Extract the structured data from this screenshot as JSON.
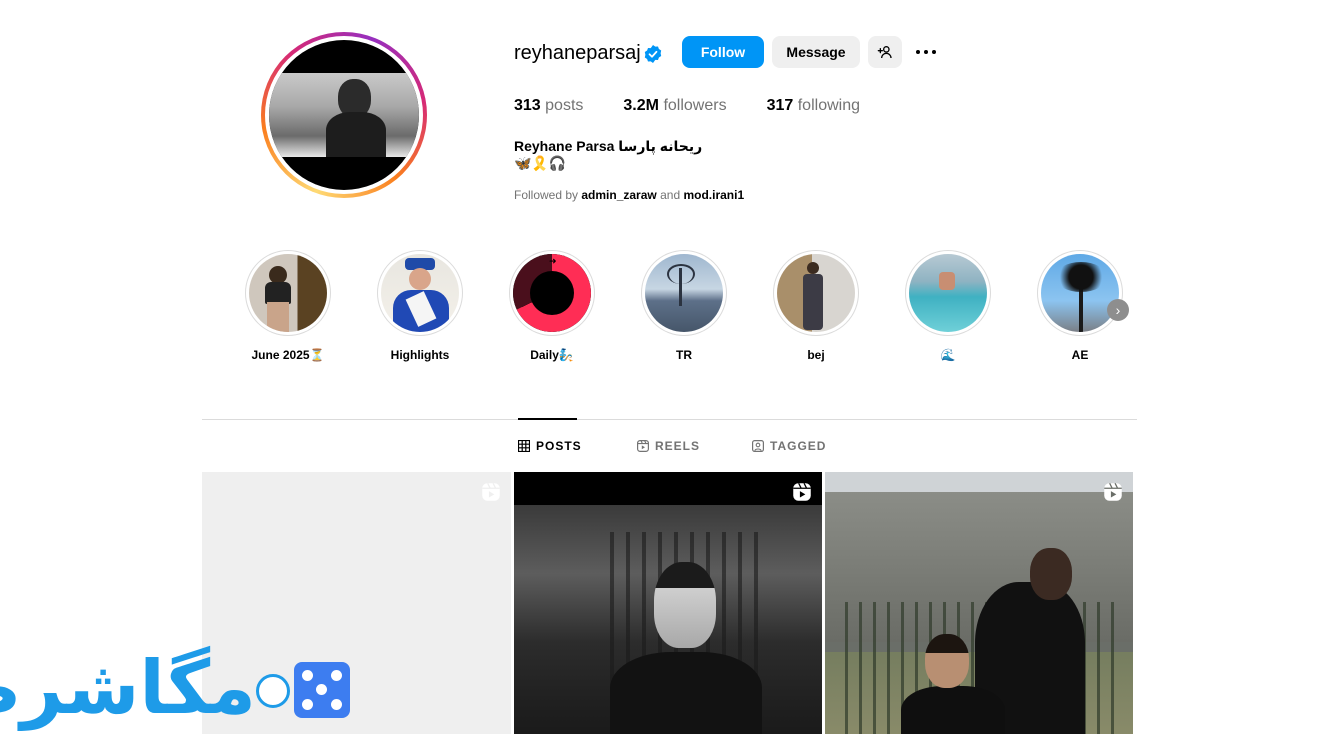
{
  "profile": {
    "username": "reyhaneparsaj",
    "follow_label": "Follow",
    "message_label": "Message",
    "stats": {
      "posts_count": "313",
      "posts_label": "posts",
      "followers_count": "3.2M",
      "followers_label": "followers",
      "following_count": "317",
      "following_label": "following"
    },
    "full_name": "Reyhane Parsa ریحانه پارسا",
    "bio_emojis": "🦋🎗️🎧",
    "followed_by_prefix": "Followed by",
    "followed_by_user1": "admin_zaraw",
    "followed_by_and": "and",
    "followed_by_user2": "mod.irani1"
  },
  "highlights": [
    {
      "label": "June 2025⏳"
    },
    {
      "label": "Highlights"
    },
    {
      "label": "Daily🧞"
    },
    {
      "label": "TR"
    },
    {
      "label": "bej"
    },
    {
      "label": "🌊"
    },
    {
      "label": "AE"
    }
  ],
  "tabs": {
    "posts": "POSTS",
    "reels": "REELS",
    "tagged": "TAGGED"
  },
  "colors": {
    "follow_button": "#0095f6",
    "secondary_button": "#efefef",
    "verified_badge": "#0095f6",
    "watermark": "#1e9be8"
  },
  "watermark": {
    "text": "مگاشرط"
  }
}
